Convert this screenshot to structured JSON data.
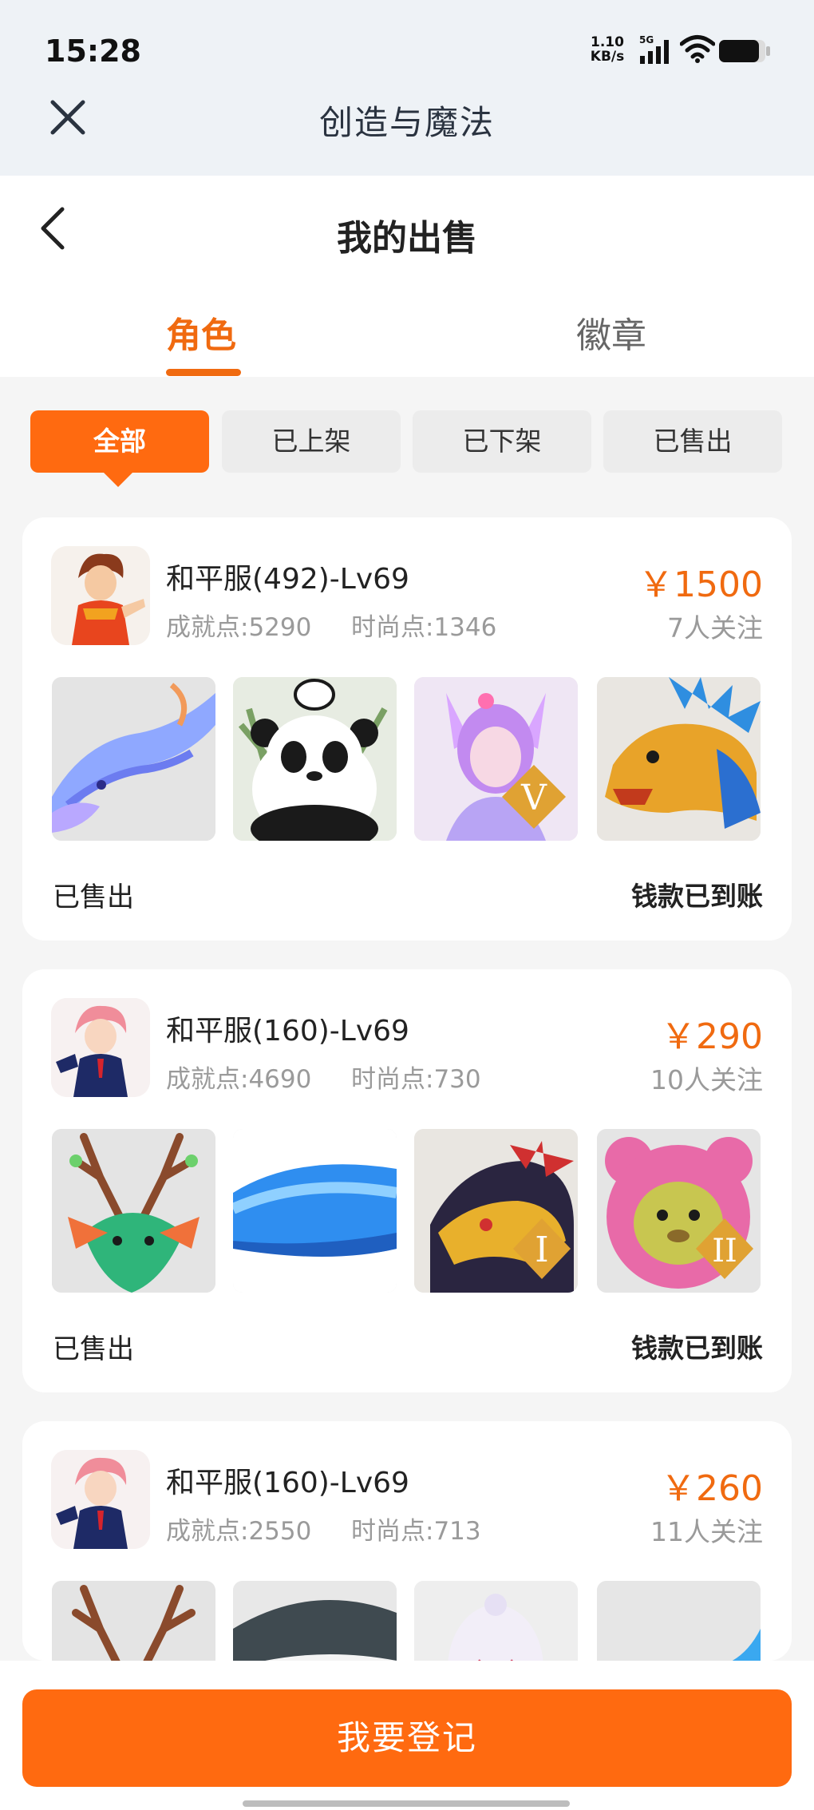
{
  "status": {
    "time": "15:28",
    "net_value": "1.10",
    "net_unit": "KB/s",
    "signal_label": "5G"
  },
  "app": {
    "title": "创造与魔法"
  },
  "page": {
    "title": "我的出售"
  },
  "tabs": [
    {
      "label": "角色",
      "active": true
    },
    {
      "label": "徽章",
      "active": false
    }
  ],
  "filters": [
    {
      "label": "全部",
      "active": true
    },
    {
      "label": "已上架"
    },
    {
      "label": "已下架"
    },
    {
      "label": "已售出"
    }
  ],
  "listings": [
    {
      "server_level": "和平服(492)-Lv69",
      "achievement": "成就点:5290",
      "fashion": "时尚点:1346",
      "price": "￥1500",
      "followers": "7人关注",
      "status": "已售出",
      "settlement": "钱款已到账",
      "items": [
        "blue-dragon-icon",
        "panda-icon",
        "fox-girl-icon",
        "fire-dragon-icon"
      ],
      "badges": [
        "",
        "",
        "V",
        ""
      ]
    },
    {
      "server_level": "和平服(160)-Lv69",
      "achievement": "成就点:4690",
      "fashion": "时尚点:730",
      "price": "￥290",
      "followers": "10人关注",
      "status": "已售出",
      "settlement": "钱款已到账",
      "items": [
        "green-deer-icon",
        "whale-icon",
        "gold-dragon-icon",
        "bear-hood-icon"
      ],
      "badges": [
        "",
        "",
        "I",
        "II"
      ]
    },
    {
      "server_level": "和平服(160)-Lv69",
      "achievement": "成就点:2550",
      "fashion": "时尚点:713",
      "price": "￥260",
      "followers": "11人关注",
      "items": [
        "green-deer-icon",
        "shark-icon",
        "white-spirit-icon",
        "water-dragon-icon"
      ]
    }
  ],
  "cta": {
    "label": "我要登记"
  },
  "colors": {
    "accent": "#ff6a10",
    "price": "#f06a10"
  }
}
